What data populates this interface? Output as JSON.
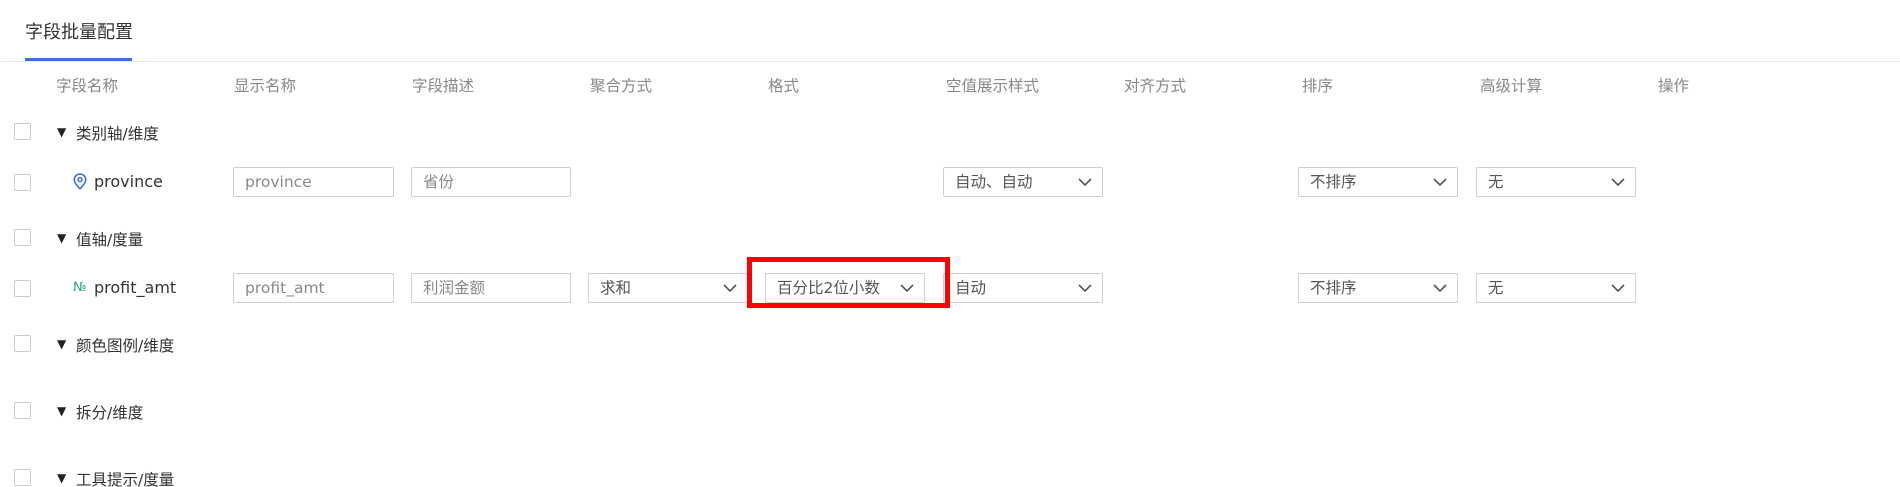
{
  "tab": {
    "label": "字段批量配置"
  },
  "headers": [
    "字段名称",
    "显示名称",
    "字段描述",
    "聚合方式",
    "格式",
    "空值展示样式",
    "对齐方式",
    "排序",
    "高级计算",
    "操作"
  ],
  "groups": {
    "category_axis": {
      "label": "类别轴/维度"
    },
    "value_axis": {
      "label": "值轴/度量"
    },
    "color_legend": {
      "label": "颜色图例/维度"
    },
    "split": {
      "label": "拆分/维度"
    },
    "tooltip": {
      "label": "工具提示/度量"
    }
  },
  "rows": {
    "province": {
      "field_name": "province",
      "icon": "location-pin-icon",
      "display_name": "province",
      "description": "省份",
      "null_style": "自动、自动",
      "sort": "不排序",
      "advanced": "无"
    },
    "profit_amt": {
      "field_name": "profit_amt",
      "icon": "numeric-icon",
      "display_name": "profit_amt",
      "description": "利润金额",
      "aggregation": "求和",
      "format": "百分比2位小数",
      "null_style": "自动",
      "sort": "不排序",
      "advanced": "无"
    }
  },
  "colors": {
    "accent": "#3b6fe0",
    "highlight": "#ff0000",
    "numeric_icon": "#2aa58a"
  }
}
